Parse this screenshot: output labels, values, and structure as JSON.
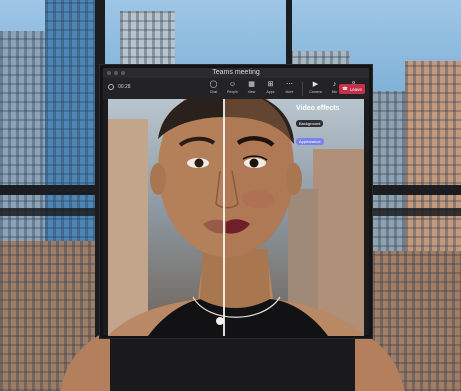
{
  "window": {
    "title": "Teams meeting"
  },
  "toolbar": {
    "timer": "00:28",
    "items": [
      {
        "label": "Chat",
        "icon": "chat-icon",
        "glyph": "◯"
      },
      {
        "label": "People",
        "icon": "people-icon",
        "glyph": "☺"
      },
      {
        "label": "View",
        "icon": "view-icon",
        "glyph": "▦"
      },
      {
        "label": "Apps",
        "icon": "apps-icon",
        "glyph": "⊞"
      },
      {
        "label": "More",
        "icon": "more-icon",
        "glyph": "⋯"
      },
      {
        "label": "Camera",
        "icon": "camera-icon",
        "glyph": "▶"
      },
      {
        "label": "Mic",
        "icon": "mic-icon",
        "glyph": "♪"
      },
      {
        "label": "Share",
        "icon": "share-icon",
        "glyph": "⇪"
      }
    ],
    "leave_label": "Leave"
  },
  "effects": {
    "title": "Video effects",
    "background_label": "Background",
    "selected_label": "Appearance"
  },
  "colors": {
    "leave": "#c4314b",
    "accent": "#7b83eb"
  }
}
